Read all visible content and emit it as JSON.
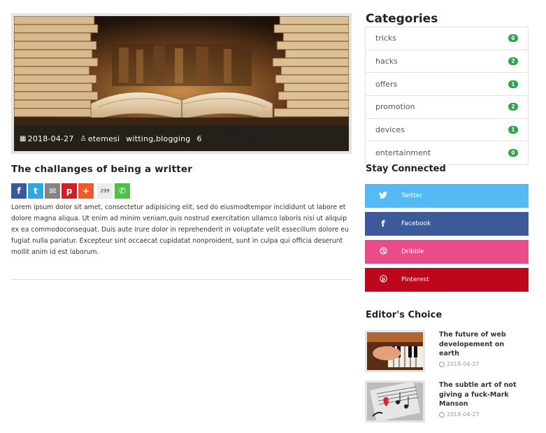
{
  "article": {
    "date": "2018-04-27",
    "author": "etemesi",
    "tags": "witting,blogging",
    "comment_count": "6",
    "title": "The challanges of being a writter",
    "share_count": "299",
    "body": "Lorem ipsum dolor sit amet, consectetur adipisicing elit, sed do eiusmodtempor incididunt ut labore et dolore magna aliqua. Ut enim ad minim veniam,quis nostrud exercitation ullamco laboris nisi ut aliquip ex ea commodoconsequat. Duis aute irure dolor in reprehenderit in voluptate velit essecillum dolore eu fugiat nulla pariatur. Excepteur sint occaecat cupidatat nonproident, sunt in culpa qui officia deserunt mollit anim id est laborum.",
    "share_buttons": [
      {
        "name": "facebook-share-icon",
        "glyph": "f",
        "color": "#3b5998"
      },
      {
        "name": "twitter-share-icon",
        "glyph": "t",
        "color": "#2da7e0"
      },
      {
        "name": "email-share-icon",
        "glyph": "✉",
        "color": "#848484"
      },
      {
        "name": "pinterest-share-icon",
        "glyph": "p",
        "color": "#cb2027"
      },
      {
        "name": "more-share-icon",
        "glyph": "+",
        "color": "#f1592a"
      },
      {
        "name": "whatsapp-share-icon",
        "glyph": "✆",
        "color": "#4dc247"
      }
    ]
  },
  "sidebar": {
    "categories_heading": "Categories",
    "categories": [
      {
        "label": "tricks",
        "count": "0"
      },
      {
        "label": "hacks",
        "count": "2"
      },
      {
        "label": "offers",
        "count": "1"
      },
      {
        "label": "promotion",
        "count": "2"
      },
      {
        "label": "devices",
        "count": "1"
      },
      {
        "label": "entertainment",
        "count": "0"
      }
    ],
    "stay_connected_heading": "Stay Connected",
    "social": [
      {
        "label": "Twitter",
        "icon": "twitter-icon",
        "color": "#55b9f2"
      },
      {
        "label": "Facebook",
        "icon": "facebook-icon",
        "color": "#3c5a99"
      },
      {
        "label": "Dribble",
        "icon": "dribbble-icon",
        "color": "#ea4c89"
      },
      {
        "label": "Pinterest",
        "icon": "pinterest-icon",
        "color": "#bd081c"
      }
    ],
    "editors_choice_heading": "Editor's Choice",
    "editors_choice": [
      {
        "title": "The future of web developement on earth",
        "date": "2018-04-27"
      },
      {
        "title": "The subtle art of not giving a fuck-Mark Manson",
        "date": "2018-04-27"
      }
    ]
  }
}
